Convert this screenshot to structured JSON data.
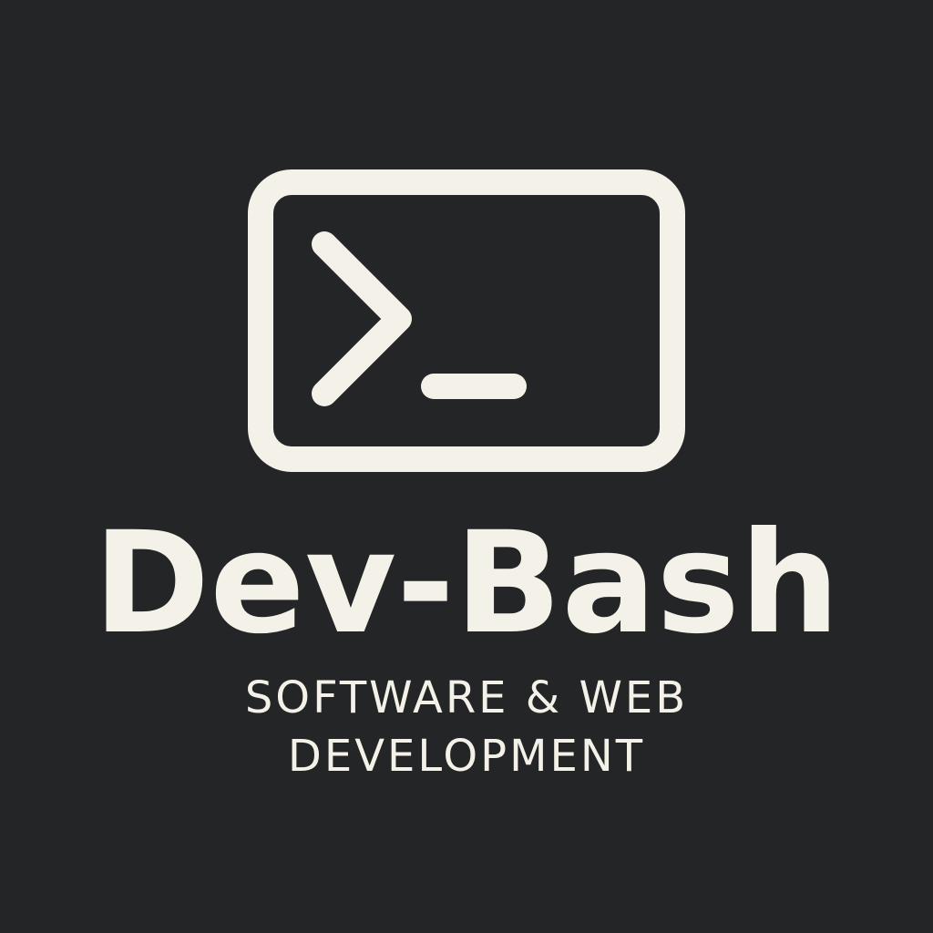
{
  "colors": {
    "background": "#232527",
    "foreground": "#f4f1e8"
  },
  "logo": {
    "icon": "terminal-prompt-icon",
    "name": "Dev-Bash",
    "tagline_line1": "SOFTWARE & WEB",
    "tagline_line2": "DEVELOPMENT"
  }
}
